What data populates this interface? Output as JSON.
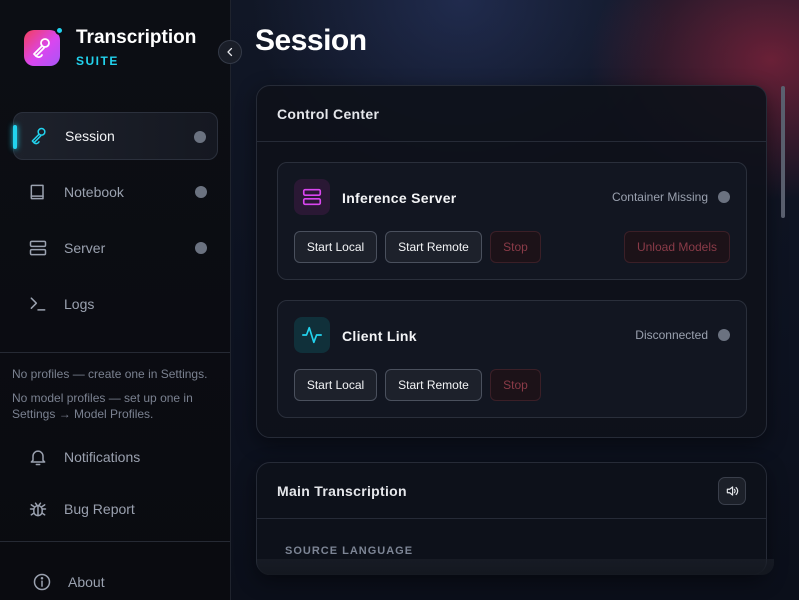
{
  "brand": {
    "title": "Transcription",
    "subtitle": "SUITE"
  },
  "nav": [
    {
      "label": "Session",
      "icon": "microphone-icon",
      "active": true
    },
    {
      "label": "Notebook",
      "icon": "book-icon"
    },
    {
      "label": "Server",
      "icon": "server-icon"
    },
    {
      "label": "Logs",
      "icon": "terminal-icon"
    }
  ],
  "sidebar_hints": [
    "No profiles — create one in Settings.",
    "No model profiles — set up one in Settings → Model Profiles."
  ],
  "nav_bottom": [
    {
      "label": "Notifications",
      "icon": "bell-icon"
    },
    {
      "label": "Bug Report",
      "icon": "bug-icon"
    },
    {
      "label": "About",
      "icon": "info-icon"
    }
  ],
  "page": {
    "title": "Session"
  },
  "control_center": {
    "title": "Control Center",
    "inference": {
      "name": "Inference Server",
      "status": "Container Missing",
      "buttons": [
        "Start Local",
        "Start Remote",
        "Stop"
      ],
      "unload": "Unload Models"
    },
    "client": {
      "name": "Client Link",
      "status": "Disconnected",
      "buttons": [
        "Start Local",
        "Start Remote",
        "Stop"
      ]
    }
  },
  "main_transcription": {
    "title": "Main Transcription",
    "source_label": "SOURCE LANGUAGE"
  },
  "colors": {
    "accent": "#22d3ee",
    "brand_gradient": [
      "#f43f5e",
      "#a855f7"
    ],
    "status_dot": "#6b7280",
    "danger_text": "#8a3b48"
  }
}
